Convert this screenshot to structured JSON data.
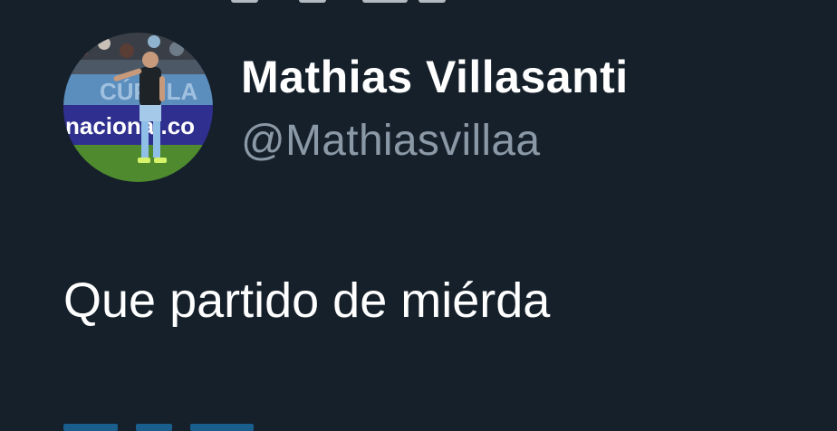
{
  "tweet": {
    "display_name": "Mathias Villasanti",
    "handle": "@Mathiasvillaa",
    "text": "Que partido de miérda"
  },
  "avatar": {
    "banner_text": "nacional.co",
    "stand_text": "CÚPULA"
  },
  "colors": {
    "background": "#15202b",
    "name": "#ffffff",
    "handle": "#8b98a5",
    "body_text": "#ffffff"
  }
}
